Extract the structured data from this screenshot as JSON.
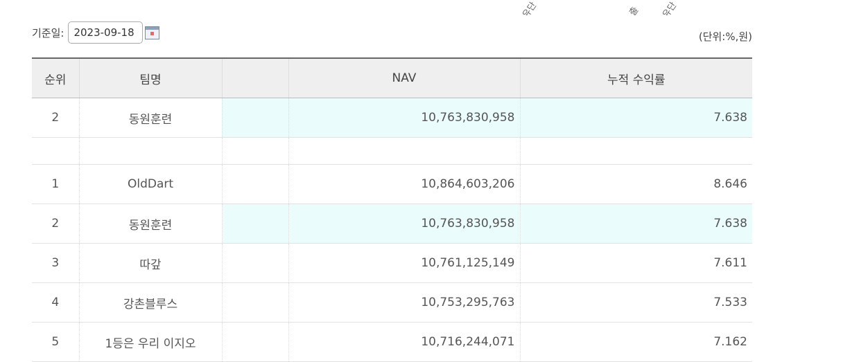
{
  "top_labels": [
    {
      "text": "유단"
    },
    {
      "text": "출"
    },
    {
      "text": "유단"
    }
  ],
  "filter": {
    "date_label": "기준일:",
    "date_value": "2023-09-18"
  },
  "unit_label": "(단위:%,원)",
  "table": {
    "headers": [
      "순위",
      "팀명",
      "",
      "NAV",
      "누적 수익률"
    ],
    "my_team_row": {
      "rank": "2",
      "team": "동원훈련",
      "nav": "10,763,830,958",
      "return": "7.638"
    },
    "rows": [
      {
        "rank": "1",
        "team": "OldDart",
        "nav": "10,864,603,206",
        "return": "8.646",
        "highlight": false
      },
      {
        "rank": "2",
        "team": "동원훈련",
        "nav": "10,763,830,958",
        "return": "7.638",
        "highlight": true
      },
      {
        "rank": "3",
        "team": "따갚",
        "nav": "10,761,125,149",
        "return": "7.611",
        "highlight": false
      },
      {
        "rank": "4",
        "team": "강촌블루스",
        "nav": "10,753,295,763",
        "return": "7.533",
        "highlight": false
      },
      {
        "rank": "5",
        "team": "1등은 우리 이지오",
        "nav": "10,716,244,071",
        "return": "7.162",
        "highlight": false
      }
    ]
  },
  "colors": {
    "highlight_bg": "#eafcfc",
    "header_bg": "#efefef"
  }
}
